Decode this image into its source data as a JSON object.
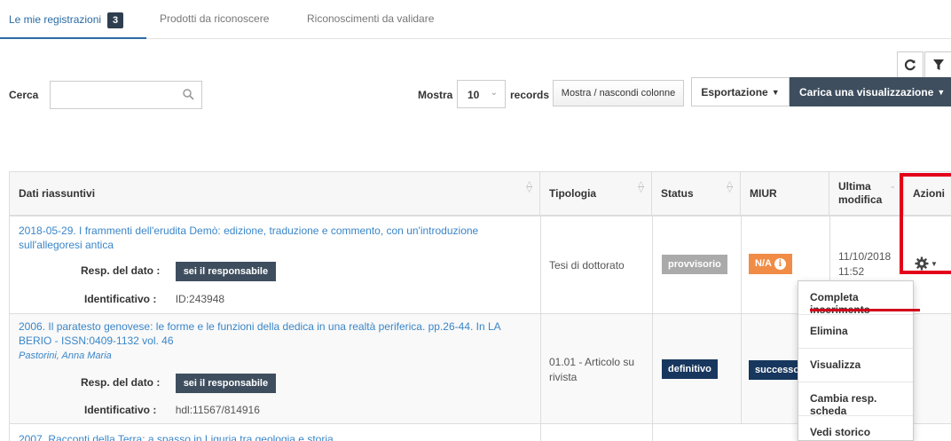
{
  "tabs": [
    {
      "label": "Le mie registrazioni",
      "badge": "3"
    },
    {
      "label": "Prodotti da riconoscere"
    },
    {
      "label": "Riconoscimenti da validare"
    }
  ],
  "toolbar": {
    "search_label": "Cerca",
    "search_value": "",
    "show_label": "Mostra",
    "page_size": "10",
    "records_label": "records",
    "columns_button": "Mostra / nascondi colonne",
    "export_button": "Esportazione",
    "load_view_button": "Carica una visualizzazione",
    "refresh_icon": "refresh-icon",
    "filter_icon": "filter-icon"
  },
  "table": {
    "headers": [
      "Dati riassuntivi",
      "Tipologia",
      "Status",
      "MIUR",
      "Ultima modifica",
      "Azioni"
    ],
    "rows": [
      {
        "title": "2018-05-29. I frammenti dell'erudita Demò: edizione, traduzione e commento, con un'introduzione sull'allegoresi antica",
        "author": "",
        "resp_label": "Resp. del dato :",
        "resp_button": "sei il responsabile",
        "id_label": "Identificativo :",
        "id_value": "ID:243948",
        "tipologia": "Tesi di dottorato",
        "status": "provvisorio",
        "miur": "N/A",
        "modified_date": "11/10/2018",
        "modified_time": "11:52"
      },
      {
        "title": "2006. Il paratesto genovese: le forme e le funzioni della dedica in una realtà periferica. pp.26-44. In LA BERIO - ISSN:0409-1132 vol. 46",
        "author": "Pastorini, Anna Maria",
        "resp_label": "Resp. del dato :",
        "resp_button": "sei il responsabile",
        "id_label": "Identificativo :",
        "id_value": "hdl:11567/814916",
        "tipologia": "01.01 - Articolo su rivista",
        "status": "definitivo",
        "miur": "successo"
      },
      {
        "title": "2007. Racconti della Terra: a spasso in Liguria tra geologia e storia"
      }
    ]
  },
  "actions_menu": {
    "items": [
      "Completa inserimento",
      "Elimina",
      "Visualizza",
      "Cambia resp. scheda",
      "Vedi storico"
    ]
  },
  "colors": {
    "accent": "#2a6ba3",
    "dark_button": "#3e4e5e",
    "status_draft": "#aaaaaa",
    "status_final": "#17375e",
    "miur_na": "#f08c45",
    "highlight_red": "#e3001b"
  }
}
